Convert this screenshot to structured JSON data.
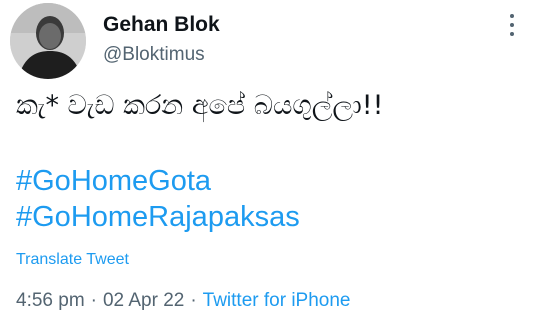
{
  "author": {
    "name": "Gehan Blok",
    "handle": "@Bloktimus",
    "avatar_icon": "user-avatar-photo"
  },
  "tweet": {
    "text": "කැ* වැඩ කරන අපේ බයගුල්ලා!!",
    "hashtags": [
      "#GoHomeGota",
      "#GoHomeRajapaksas"
    ],
    "translate_label": "Translate Tweet"
  },
  "meta": {
    "time": "4:56 pm",
    "date": "02 Apr 22",
    "separator": "·",
    "source": "Twitter for iPhone"
  },
  "icons": {
    "more": "more-options-icon"
  },
  "colors": {
    "link": "#1d9bf0",
    "secondary_text": "#536471",
    "primary_text": "#0f1419",
    "background": "#ffffff"
  }
}
